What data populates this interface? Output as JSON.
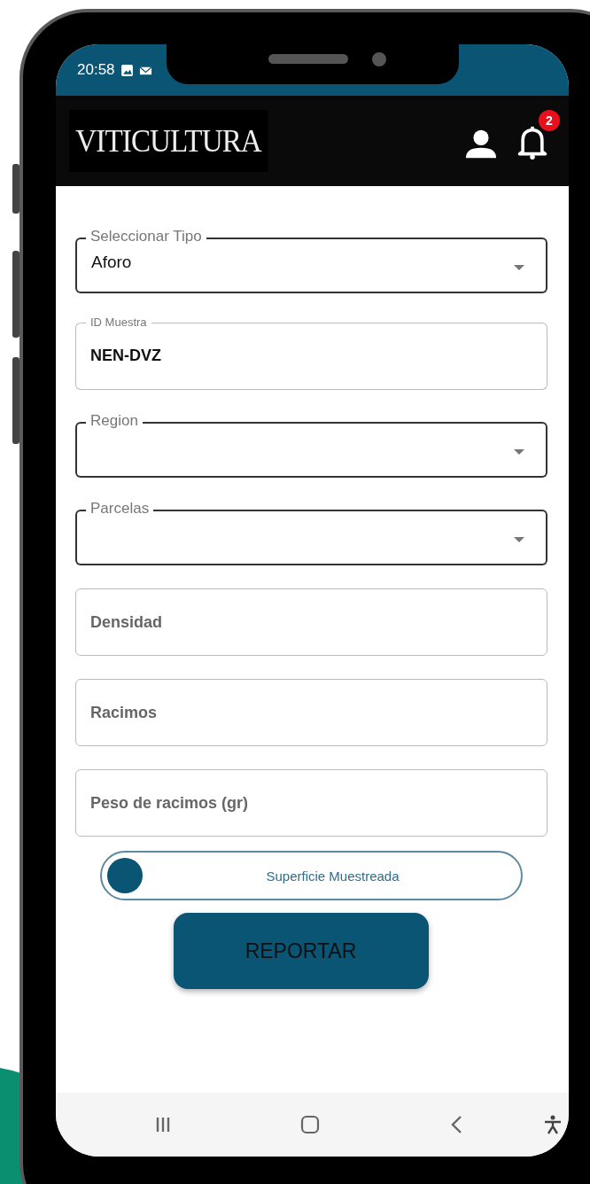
{
  "status_bar": {
    "time": "20:58"
  },
  "header": {
    "logo": "VITICULTURA",
    "notification_count": "2"
  },
  "form": {
    "fields": [
      {
        "kind": "select",
        "label": "Seleccionar Tipo",
        "value": "Aforo"
      },
      {
        "kind": "text",
        "label": "ID Muestra",
        "value": "NEN-DVZ"
      },
      {
        "kind": "select",
        "label": "Region"
      },
      {
        "kind": "select",
        "label": "Parcelas"
      },
      {
        "kind": "text",
        "placeholder": "Densidad"
      },
      {
        "kind": "text",
        "placeholder": "Racimos"
      },
      {
        "kind": "text",
        "placeholder": "Peso de racimos (gr)"
      }
    ],
    "switch": {
      "label": "Superficie Muestreada",
      "on": false
    },
    "submit": "REPORTAR"
  }
}
